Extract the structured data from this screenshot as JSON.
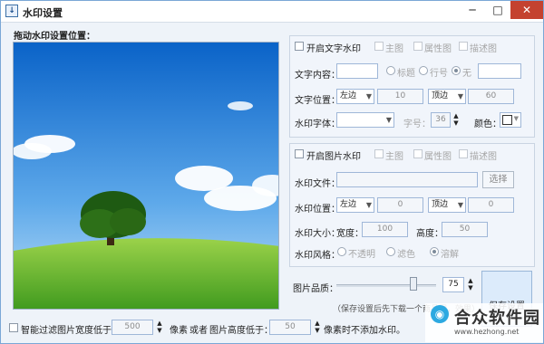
{
  "window": {
    "title": "水印设置",
    "app_icon": "download-icon",
    "min": "─",
    "max": "□",
    "close": "✕"
  },
  "preview_label": "拖动水印设置位置：",
  "text_watermark": {
    "enable_label": "开启文字水印",
    "checks": [
      "主图",
      "属性图",
      "描述图"
    ],
    "content_label": "文字内容：",
    "content_value": "",
    "radio_options": [
      "标题",
      "行号",
      "无"
    ],
    "selected_radio": "无",
    "extra_value": "",
    "position_label": "文字位置：",
    "h_align": "左边",
    "h_offset": "10",
    "v_align": "顶边",
    "v_offset": "60",
    "font_label": "水印字体：",
    "font_value": "",
    "size_label": "字号：",
    "size_value": "36",
    "color_label": "颜色："
  },
  "image_watermark": {
    "enable_label": "开启图片水印",
    "checks": [
      "主图",
      "属性图",
      "描述图"
    ],
    "file_label": "水印文件：",
    "file_value": "",
    "choose_label": "选择",
    "position_label": "水印位置：",
    "h_align": "左边",
    "h_offset": "0",
    "v_align": "顶边",
    "v_offset": "0",
    "size_label": "水印大小：",
    "width_label": "宽度：",
    "width_value": "100",
    "height_label": "高度：",
    "height_value": "50",
    "style_label": "水印风格：",
    "style_options": [
      "不透明",
      "滤色",
      "溶解"
    ],
    "selected_style": "溶解"
  },
  "quality": {
    "label": "图片品质：",
    "value": "75",
    "slider_level": 75,
    "note": "（保存设置后先下载一个商品图，效果）"
  },
  "save_label": "保存设置",
  "filter": {
    "label": "智能过滤图片宽度低于：",
    "width_value": "500",
    "unit": "像素",
    "or_label": "或者",
    "height_label": "图片高度低于：",
    "height_value": "50",
    "tail": "像素时不添加水印。"
  },
  "watermark_overlay": {
    "brand": "合众软件园",
    "url": "www.hezhong.net",
    "logo_icon": "hezhong-logo-icon"
  },
  "colors": {
    "accent": "#2f6fc0",
    "close": "#c4422f",
    "panel": "#f1f5fb"
  }
}
